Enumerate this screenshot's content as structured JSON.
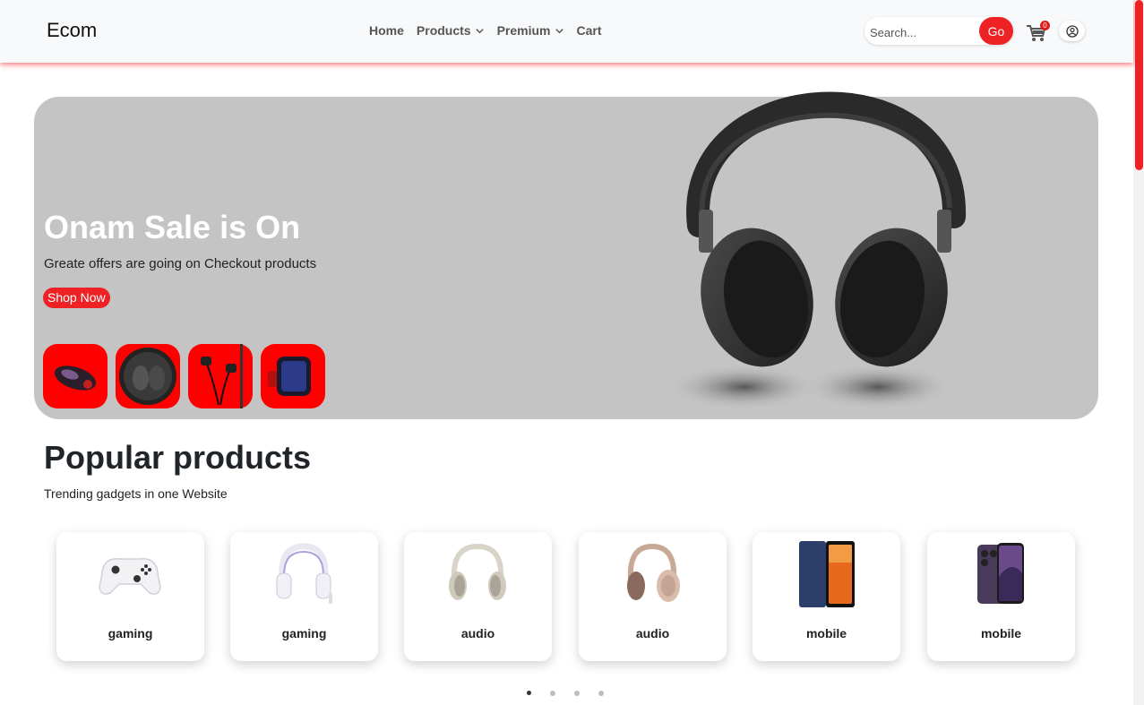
{
  "navbar": {
    "brand": "Ecom",
    "links": [
      {
        "label": "Home",
        "dropdown": false
      },
      {
        "label": "Products",
        "dropdown": true
      },
      {
        "label": "Premium",
        "dropdown": true
      },
      {
        "label": "Cart",
        "dropdown": false
      }
    ],
    "search": {
      "placeholder": "Search...",
      "button_label": "Go"
    },
    "cart_count": "0",
    "cart_icon": "shopping-cart-icon",
    "user_icon": "user-circle-icon"
  },
  "hero": {
    "title": "Onam Sale is On",
    "subtitle": "Greate offers are going on Checkout products",
    "button_label": "Shop Now",
    "thumbnails": [
      "earbuds-case-icon",
      "tws-earbuds-icon",
      "wired-earphones-icon",
      "smartwatch-icon"
    ],
    "image": "black-headphones"
  },
  "popular": {
    "title": "Popular products",
    "subtitle": "Trending gadgets in one Website",
    "cards": [
      {
        "label": "gaming",
        "image": "game-controller"
      },
      {
        "label": "gaming",
        "image": "gaming-headset"
      },
      {
        "label": "audio",
        "image": "over-ear-headphones"
      },
      {
        "label": "audio",
        "image": "over-ear-headphones"
      },
      {
        "label": "mobile",
        "image": "smartphone"
      },
      {
        "label": "mobile",
        "image": "smartphone"
      }
    ],
    "pagination": {
      "pages": 4,
      "active": 1
    }
  },
  "colors": {
    "accent": "#ee2225",
    "hero_bg": "#c4c4c4",
    "navbar_bg": "#f8f9fa",
    "thumb_bg": "#ff0000"
  }
}
